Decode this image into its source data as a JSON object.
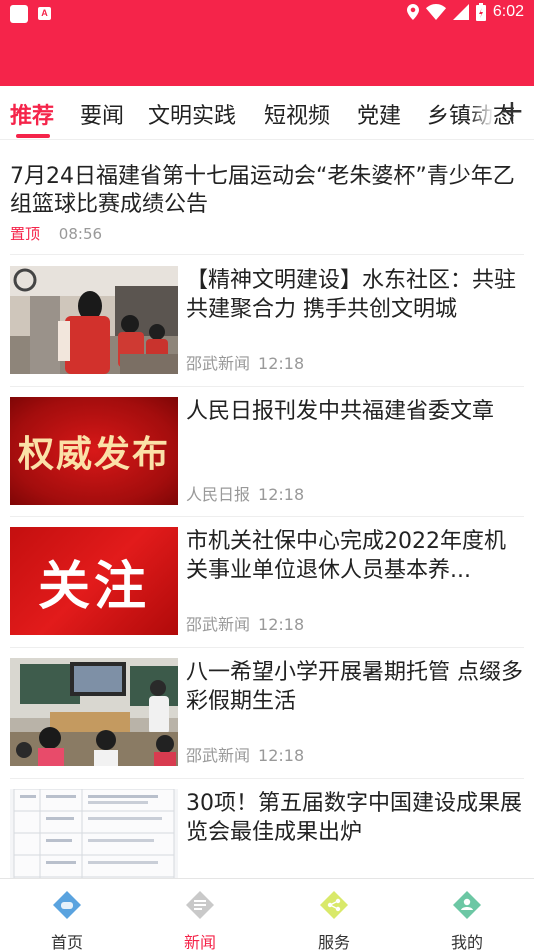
{
  "status": {
    "time": "6:02"
  },
  "tabs": [
    {
      "label": "推荐",
      "active": true
    },
    {
      "label": "要闻"
    },
    {
      "label": "文明实践"
    },
    {
      "label": "短视频"
    },
    {
      "label": "党建"
    },
    {
      "label": "乡镇动态"
    }
  ],
  "top_item": {
    "title": "7月24日福建省第十七届运动会“老朱婆杯”青少年乙组篮球比赛成绩公告",
    "pin": "置顶",
    "time": "08:56"
  },
  "news": [
    {
      "title": "【精神文明建设】水东社区：共驻共建聚合力 携手共创文明城",
      "source": "邵武新闻",
      "time": "12:18",
      "thumb": "volunteers-photo"
    },
    {
      "title": "人民日报刊发中共福建省委文章",
      "source": "人民日报",
      "time": "12:18",
      "thumb_text": "权威发布"
    },
    {
      "title": "市机关社保中心完成2022年度机关事业单位退休人员基本养...",
      "source": "邵武新闻",
      "time": "12:18",
      "thumb_text": "关注"
    },
    {
      "title": "八一希望小学开展暑期托管 点缀多彩假期生活",
      "source": "邵武新闻",
      "time": "12:18",
      "thumb": "classroom-photo"
    },
    {
      "title": "30项！第五届数字中国建设成果展览会最佳成果出炉",
      "source": "",
      "time": "",
      "thumb": "document-table-image"
    }
  ],
  "bottom_nav": [
    {
      "label": "首页",
      "icon": "home-icon"
    },
    {
      "label": "新闻",
      "icon": "news-icon",
      "active": true
    },
    {
      "label": "服务",
      "icon": "share-icon"
    },
    {
      "label": "我的",
      "icon": "profile-icon"
    }
  ],
  "colors": {
    "accent": "#f5244a"
  }
}
